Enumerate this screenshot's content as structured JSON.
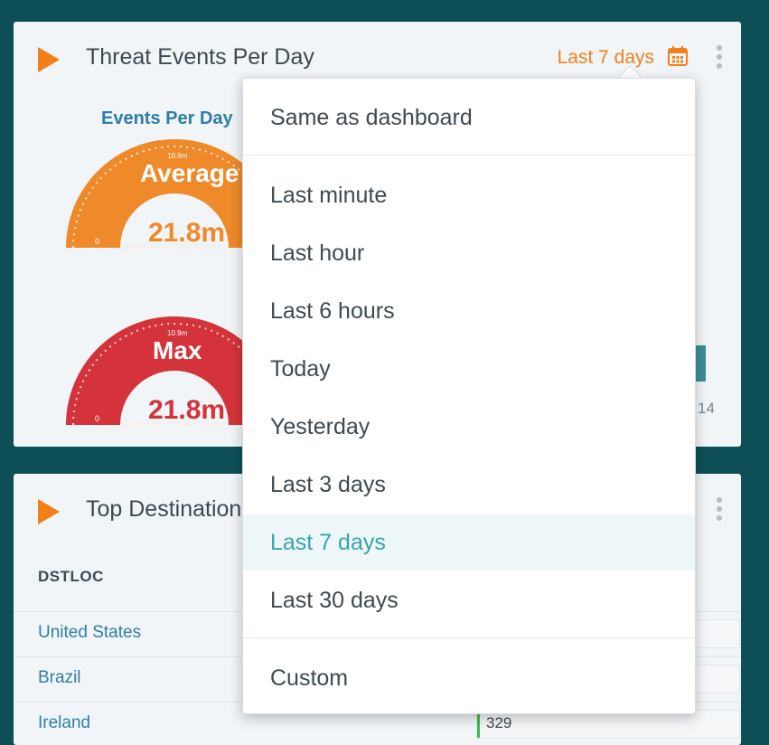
{
  "panel_top": {
    "title": "Threat Events Per Day",
    "range_label": "Last 7 days",
    "gauges_title": "Events Per Day",
    "gauge_average": {
      "label": "Average",
      "value": "21.8m",
      "scale_mark": "10.9m",
      "min_label": "0",
      "color": "#ee8a2a",
      "value_color": "#ee8a2a"
    },
    "gauge_max": {
      "label": "Max",
      "value": "21.8m",
      "scale_mark": "10.9m",
      "min_label": "0",
      "color": "#d4333b",
      "value_color": "#d4333b"
    },
    "axis_tick": "14"
  },
  "panel_bottom": {
    "title": "Top Destinations",
    "column_header": "DSTLOC",
    "rows": [
      {
        "country": "United States",
        "value": ""
      },
      {
        "country": "Brazil",
        "value": ""
      },
      {
        "country": "Ireland",
        "value": "329"
      }
    ]
  },
  "dropdown": {
    "items": [
      {
        "label": "Same as dashboard"
      },
      {
        "label": "Last minute"
      },
      {
        "label": "Last hour"
      },
      {
        "label": "Last 6 hours"
      },
      {
        "label": "Today"
      },
      {
        "label": "Yesterday"
      },
      {
        "label": "Last 3 days"
      },
      {
        "label": "Last 7 days",
        "selected": true
      },
      {
        "label": "Last 30 days"
      },
      {
        "label": "Custom"
      }
    ]
  },
  "colors": {
    "background": "#0e4f57",
    "accent_orange": "#f0801a",
    "link_blue": "#2e7fa7",
    "selected_teal": "#3aa2b0"
  }
}
